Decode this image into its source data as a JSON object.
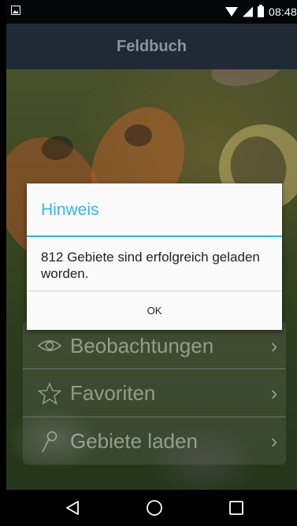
{
  "status_bar": {
    "time": "08:48",
    "icons": [
      "image-notification-icon",
      "wifi-icon",
      "signal-icon",
      "battery-charging-icon"
    ]
  },
  "action_bar": {
    "title": "Feldbuch"
  },
  "menu": {
    "items": [
      {
        "label": "Beobachtungen",
        "icon": "eye-icon"
      },
      {
        "label": "Favoriten",
        "icon": "star-icon"
      },
      {
        "label": "Gebiete laden",
        "icon": "pin-icon"
      }
    ]
  },
  "dialog": {
    "title": "Hinweis",
    "message": "812 Gebiete sind erfolgreich geladen worden.",
    "ok_label": "OK"
  },
  "nav_bar": {
    "icons": [
      "back-icon",
      "home-icon",
      "recents-icon"
    ]
  },
  "colors": {
    "accent": "#33b5e5",
    "action_bar_bg": "#1f2a34",
    "dialog_bg": "#fafafa"
  }
}
